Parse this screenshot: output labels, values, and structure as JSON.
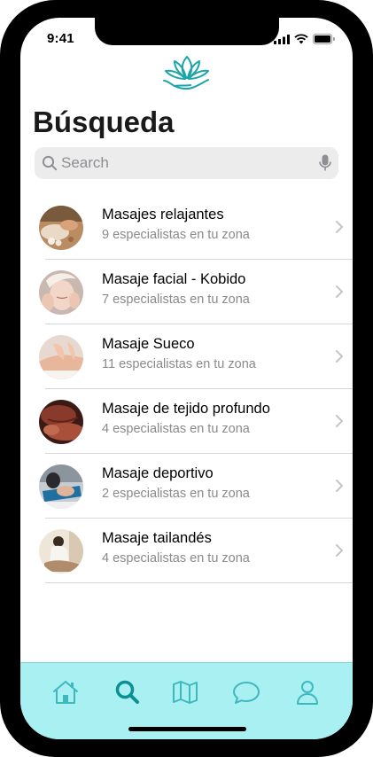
{
  "status_bar": {
    "time": "9:41"
  },
  "page": {
    "title": "Búsqueda"
  },
  "search": {
    "placeholder": "Search"
  },
  "results": [
    {
      "name": "Masajes relajantes",
      "subtitle": "9 especialistas en tu zona"
    },
    {
      "name": "Masaje facial - Kobido",
      "subtitle": "7 especialistas en tu zona"
    },
    {
      "name": "Masaje Sueco",
      "subtitle": "11 especialistas en tu zona"
    },
    {
      "name": "Masaje de tejido profundo",
      "subtitle": "4 especialistas en tu zona"
    },
    {
      "name": "Masaje deportivo",
      "subtitle": "2 especialistas en tu zona"
    },
    {
      "name": "Masaje tailandés",
      "subtitle": "4 especialistas en tu zona"
    }
  ],
  "tab_bar": {
    "tabs": [
      {
        "icon": "home-icon"
      },
      {
        "icon": "search-icon",
        "active": true
      },
      {
        "icon": "map-icon"
      },
      {
        "icon": "chat-icon"
      },
      {
        "icon": "profile-icon"
      }
    ]
  },
  "colors": {
    "accent": "#1aa5a8",
    "tab_bar_bg": "#a8f0f2",
    "active_tab": "#0c8f94"
  }
}
